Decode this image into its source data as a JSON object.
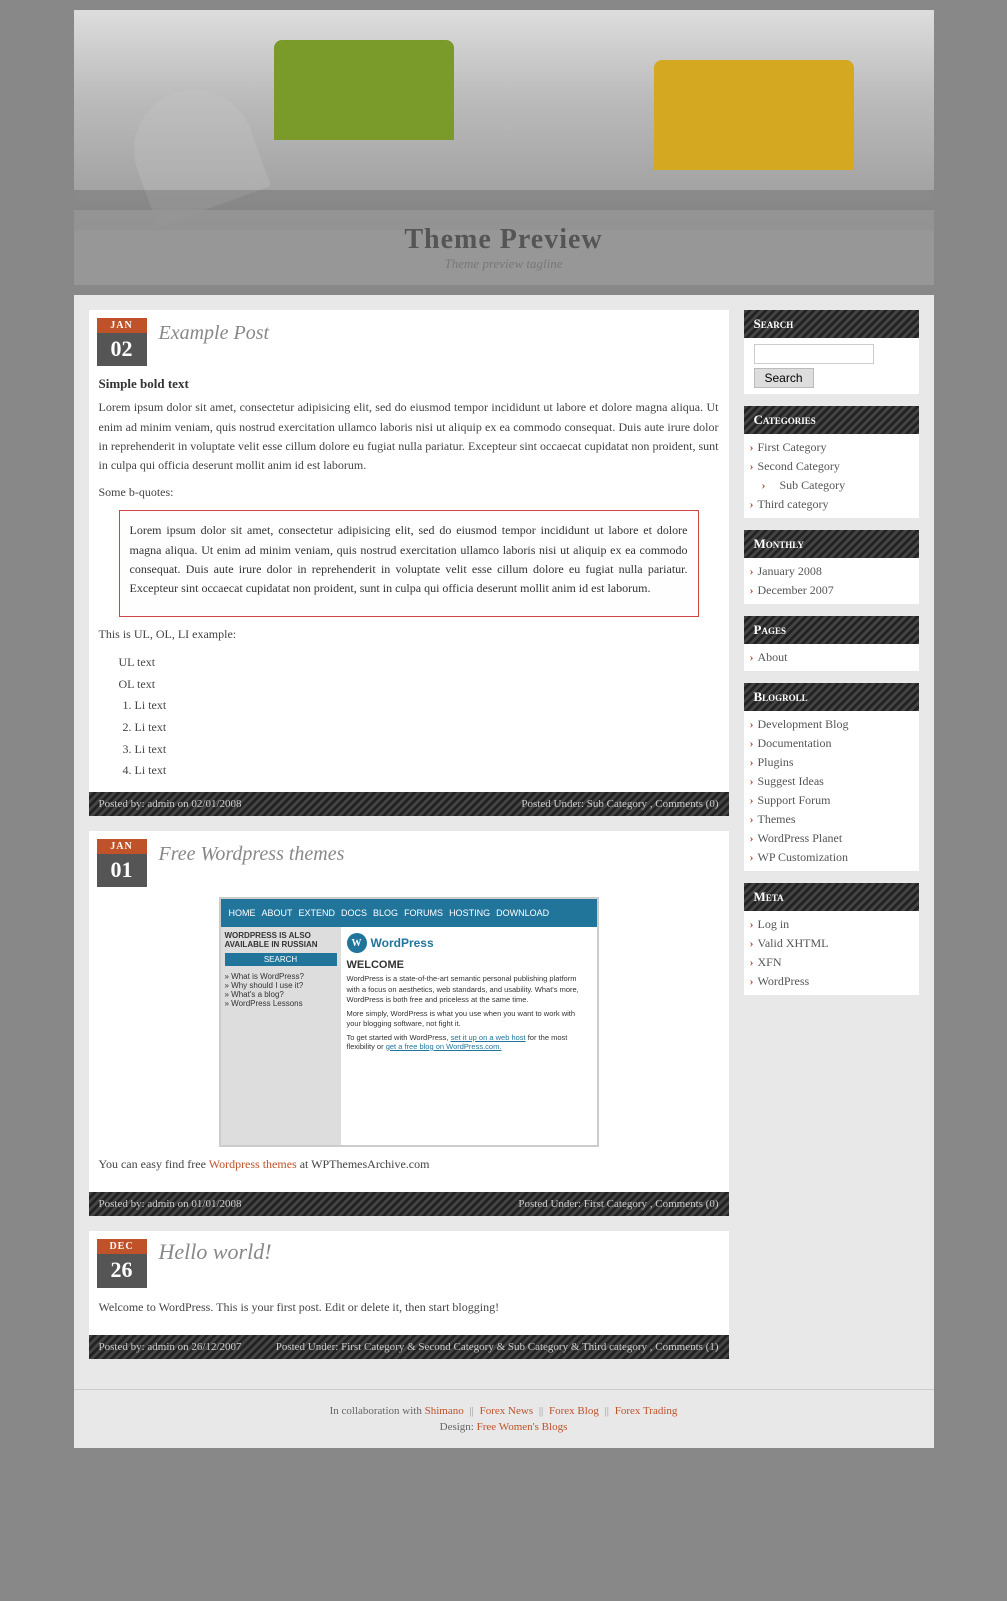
{
  "site": {
    "title": "Theme Preview",
    "tagline": "Theme preview tagline"
  },
  "posts": [
    {
      "id": "example-post",
      "month": "JAN",
      "day": "02",
      "title": "Example Post",
      "bold_text": "Simple bold text",
      "body_text": "Lorem ipsum dolor sit amet, consectetur adipisicing elit, sed do eiusmod tempor incididunt ut labore et dolore magna aliqua. Ut enim ad minim veniam, quis nostrud exercitation ullamco laboris nisi ut aliquip ex ea commodo consequat. Duis aute irure dolor in reprehenderit in voluptate velit esse cillum dolore eu fugiat nulla pariatur. Excepteur sint occaecat cupidatat non proident, sunt in culpa qui officia deserunt mollit anim id est laborum.",
      "bquote_label": "Some b-quotes:",
      "blockquote": "Lorem ipsum dolor sit amet, consectetur adipisicing elit, sed do eiusmod tempor incididunt ut labore et dolore magna aliqua. Ut enim ad minim veniam, quis nostrud exercitation ullamco laboris nisi ut aliquip ex ea commodo consequat. Duis aute irure dolor in reprehenderit in voluptate velit esse cillum dolore eu fugiat nulla pariatur. Excepteur sint occaecat cupidatat non proident, sunt in culpa qui officia deserunt mollit anim id est laborum.",
      "ul_ol_label": "This is UL, OL, LI example:",
      "ul_items": [
        "UL text",
        "OL text"
      ],
      "ol_items": [
        "Li text",
        "Li text",
        "Li text",
        "Li text"
      ],
      "footer_left": "Posted by: admin on 02/01/2008",
      "footer_right": "Posted Under: Sub Category , Comments (0)"
    },
    {
      "id": "free-wordpress-themes",
      "month": "JAN",
      "day": "01",
      "title": "Free Wordpress themes",
      "body_before": "You can easy find free ",
      "link_text": "Wordpress themes",
      "link_url": "#",
      "body_after": " at WPThemesArchive.com",
      "footer_left": "Posted by: admin on 01/01/2008",
      "footer_right": "Posted Under: First Category , Comments (0)"
    },
    {
      "id": "hello-world",
      "month": "DEC",
      "day": "26",
      "title": "Hello world!",
      "body_text": "Welcome to WordPress. This is your first post. Edit or delete it, then start blogging!",
      "footer_left": "Posted by: admin on 26/12/2007",
      "footer_right": "Posted Under: First Category & Second Category & Sub Category & Third category , Comments (1)"
    }
  ],
  "sidebar": {
    "search": {
      "title": "Search",
      "button_label": "Search",
      "placeholder": ""
    },
    "categories": {
      "title": "Categories",
      "items": [
        {
          "label": "First Category",
          "sub": false
        },
        {
          "label": "Second Category",
          "sub": false
        },
        {
          "label": "Sub Category",
          "sub": true
        },
        {
          "label": "Third category",
          "sub": false
        }
      ]
    },
    "monthly": {
      "title": "Monthly",
      "items": [
        {
          "label": "January 2008"
        },
        {
          "label": "December 2007"
        }
      ]
    },
    "pages": {
      "title": "Pages",
      "items": [
        {
          "label": "About"
        }
      ]
    },
    "blogroll": {
      "title": "Blogroll",
      "items": [
        {
          "label": "Development Blog"
        },
        {
          "label": "Documentation"
        },
        {
          "label": "Plugins"
        },
        {
          "label": "Suggest Ideas"
        },
        {
          "label": "Support Forum"
        },
        {
          "label": "Themes"
        },
        {
          "label": "WordPress Planet"
        },
        {
          "label": "WP Customization"
        }
      ]
    },
    "meta": {
      "title": "Meta",
      "items": [
        {
          "label": "Log in"
        },
        {
          "label": "Valid XHTML"
        },
        {
          "label": "XFN"
        },
        {
          "label": "WordPress"
        }
      ]
    }
  },
  "footer": {
    "collab_text": "In collaboration with",
    "shimano": "Shimano",
    "sep1": "||",
    "forex_news": "Forex News",
    "sep2": "||",
    "forex_blog": "Forex Blog",
    "sep3": "||",
    "forex_trading": "Forex Trading",
    "design_text": "Design:",
    "design_link": "Free Women's Blogs"
  }
}
